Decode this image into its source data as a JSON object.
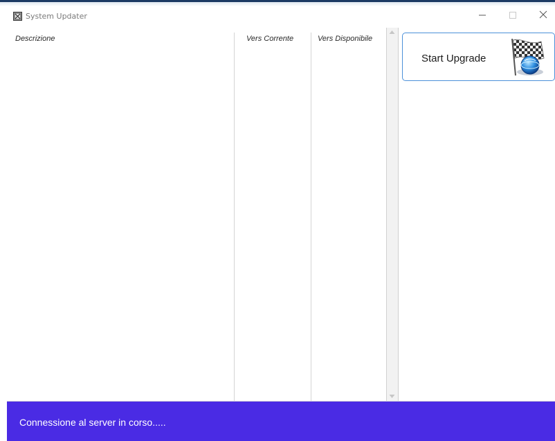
{
  "window": {
    "title": "System Updater"
  },
  "list": {
    "columns": [
      "Descrizione",
      "Vers Corrente",
      "Vers Disponibile"
    ],
    "rows": []
  },
  "actions": {
    "start_upgrade_label": "Start Upgrade"
  },
  "status": {
    "text": "Connessione al server in corso....."
  },
  "icons": {
    "app": "app-icon",
    "upgrade": "checkered-flag-globe-icon",
    "minimize": "minimize-icon",
    "maximize": "maximize-icon",
    "close": "close-icon"
  },
  "colors": {
    "status_bar": "#4a2be4",
    "button_border": "#4a90d9",
    "title_text": "#7a7a7a"
  }
}
